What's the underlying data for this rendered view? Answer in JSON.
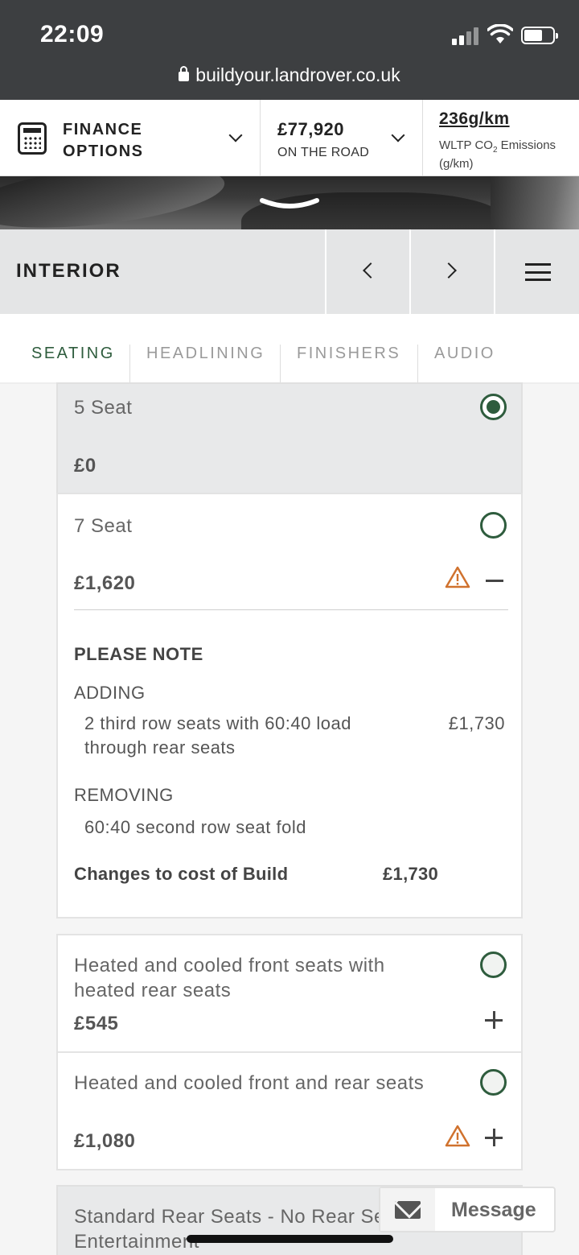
{
  "status_bar": {
    "time": "22:09",
    "url": "buildyour.landrover.co.uk"
  },
  "top_bar": {
    "finance_label": "FINANCE OPTIONS",
    "price": "£77,920",
    "price_sub": "ON THE ROAD",
    "emission_value": "236g/km",
    "emission_label_pre": "WLTP CO",
    "emission_label_sub": "2",
    "emission_label_post": " Emissions (g/km)"
  },
  "section": {
    "title": "INTERIOR"
  },
  "tabs": [
    {
      "label": "SEATING",
      "active": true
    },
    {
      "label": "HEADLINING",
      "active": false
    },
    {
      "label": "FINISHERS",
      "active": false
    },
    {
      "label": "AUDIO",
      "active": false
    }
  ],
  "options": [
    {
      "title": "5 Seat",
      "price": "£0",
      "selected": true
    },
    {
      "title": "7 Seat",
      "price": "£1,620",
      "selected": false,
      "warning": true,
      "expanded": true
    },
    {
      "title": "Heated and cooled front seats with heated rear seats",
      "price": "£545",
      "selected": false
    },
    {
      "title": "Heated and cooled front and rear seats",
      "price": "£1,080",
      "selected": false,
      "warning": true
    },
    {
      "title": "Standard Rear Seats - No Rear Seat Entertainment",
      "price": "",
      "selected": false
    }
  ],
  "note": {
    "heading": "PLEASE NOTE",
    "adding_label": "ADDING",
    "adding_item": "2 third row seats with 60:40 load through rear seats",
    "adding_amount": "£1,730",
    "removing_label": "REMOVING",
    "removing_item": "60:40 second row seat fold",
    "total_label": "Changes to cost of Build",
    "total_amount": "£1,730"
  },
  "message_widget": {
    "label": "Message"
  },
  "colors": {
    "accent_green": "#2e5c3d",
    "warning_orange": "#d0722e",
    "header_dark": "#3d3f41"
  }
}
